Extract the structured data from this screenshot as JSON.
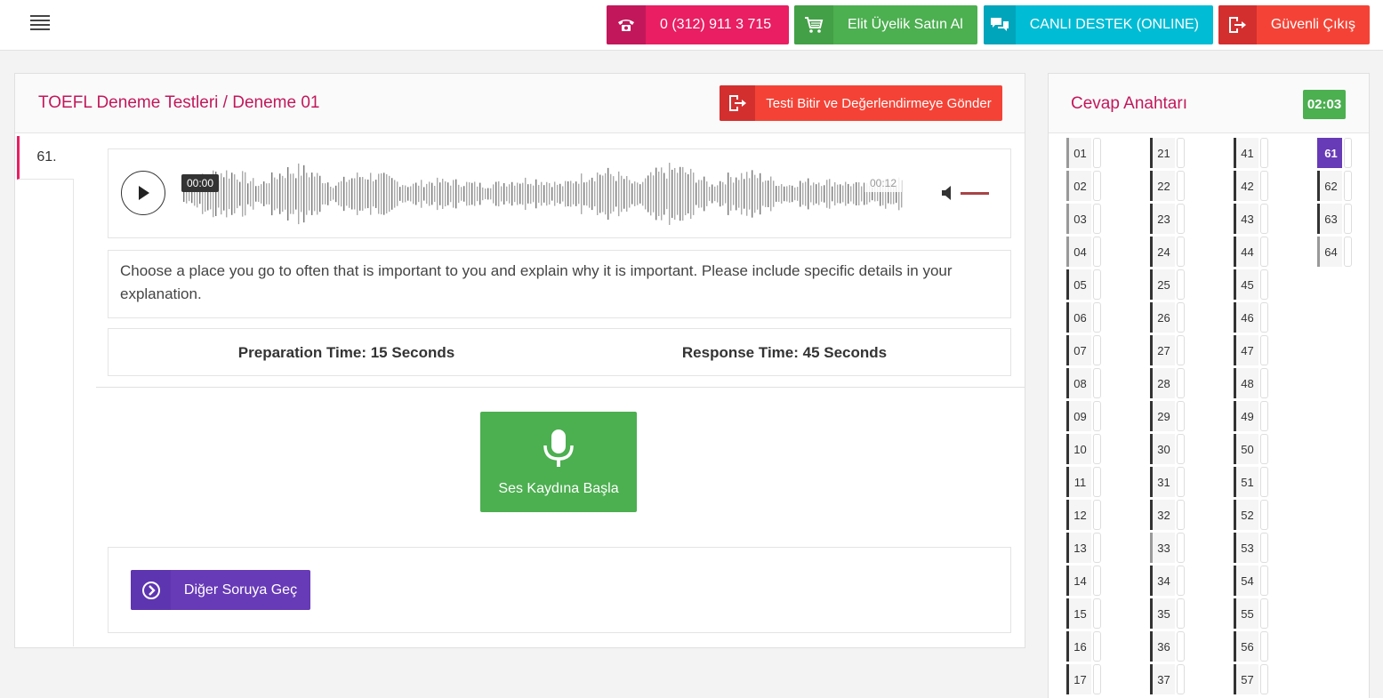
{
  "topbar": {
    "phone_label": "0 (312) 911 3 715",
    "elite_label": "Elit Üyelik Satın Al",
    "support_label": "CANLI DESTEK (ONLINE)",
    "logout_label": "Güvenli Çıkış"
  },
  "main": {
    "title": "TOEFL Deneme Testleri / Deneme 01",
    "finish_label": "Testi Bitir ve Değerlendirmeye Gönder",
    "question_number": "61.",
    "audio": {
      "current_time": "00:00",
      "total_time": "00:12"
    },
    "question_text": "Choose a place you go to often that is important to you and explain why it is important. Please include specific details in your explanation.",
    "prep_time": "Preparation Time: 15 Seconds",
    "response_time": "Response Time: 45 Seconds",
    "record_label": "Ses Kaydına Başla",
    "next_label": "Diğer Soruya Geç"
  },
  "answer_key": {
    "title": "Cevap Anahtarı",
    "timer": "02:03",
    "columns": [
      [
        "01",
        "02",
        "03",
        "04",
        "05",
        "06",
        "07",
        "08",
        "09",
        "10",
        "11",
        "12",
        "13",
        "14",
        "15",
        "16",
        "17"
      ],
      [
        "21",
        "22",
        "23",
        "24",
        "25",
        "26",
        "27",
        "28",
        "29",
        "30",
        "31",
        "32",
        "33",
        "34",
        "35",
        "36",
        "37"
      ],
      [
        "41",
        "42",
        "43",
        "44",
        "45",
        "46",
        "47",
        "48",
        "49",
        "50",
        "51",
        "52",
        "53",
        "54",
        "55",
        "56",
        "57"
      ],
      [
        "61",
        "62",
        "63",
        "64"
      ]
    ],
    "active": "61",
    "answered": [
      "01",
      "02",
      "03",
      "04",
      "33",
      "64"
    ]
  },
  "colors": {
    "accent_pink": "#e91e63",
    "green": "#4caf50",
    "cyan": "#00bcd4",
    "red": "#f44336",
    "purple": "#673ab7"
  }
}
